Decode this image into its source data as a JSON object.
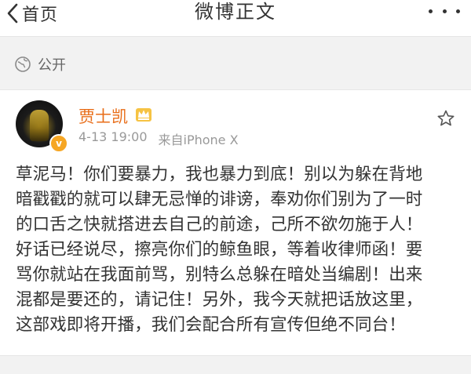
{
  "navbar": {
    "back_label": "首页",
    "title": "微博正文"
  },
  "visibility": {
    "label": "公开"
  },
  "post": {
    "author": "贾士凯",
    "date": "4-13 19:00",
    "source": "来自iPhone X",
    "verified_mark": "v",
    "text": "草泥马！你们要暴力，我也暴力到底！别以为躲在背地\n暗戳戳的就可以肆无忌惮的诽谤，奉劝你们别为了一时\n的口舌之快就搭进去自己的前途，己所不欲勿施于人！\n好话已经说尽，擦亮你们的鲸鱼眼，等着收律师函！要\n骂你就站在我面前骂，别特么总躲在暗处当编剧！出来\n混都是要还的，请记住！另外，我今天就把话放这里，\n这部戏即将开播，我们会配合所有宣传但绝不同台！"
  },
  "colors": {
    "username": "#e86d18",
    "meta_text": "#999999",
    "body_text": "#333333",
    "background": "#f2f2f2",
    "card": "#ffffff",
    "badge": "#f6a623"
  },
  "icons": {
    "back": "chevron-left-icon",
    "more": "more-dots-icon",
    "visibility": "globe-icon",
    "member": "crown-badge-icon",
    "favorite": "star-outline-icon"
  }
}
